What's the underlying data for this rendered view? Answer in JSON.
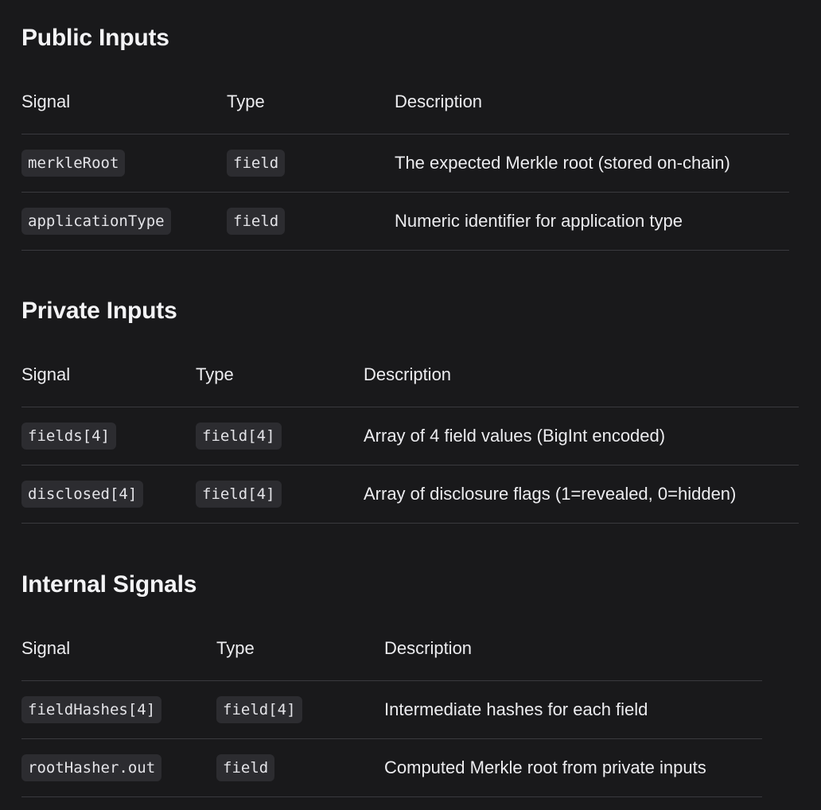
{
  "sections": {
    "public": {
      "title": "Public Inputs",
      "headers": [
        "Signal",
        "Type",
        "Description"
      ],
      "rows": [
        {
          "signal": "merkleRoot",
          "type": "field",
          "description": "The expected Merkle root (stored on-chain)"
        },
        {
          "signal": "applicationType",
          "type": "field",
          "description": "Numeric identifier for application type"
        }
      ]
    },
    "private": {
      "title": "Private Inputs",
      "headers": [
        "Signal",
        "Type",
        "Description"
      ],
      "rows": [
        {
          "signal": "fields[4]",
          "type": "field[4]",
          "description": "Array of 4 field values (BigInt encoded)"
        },
        {
          "signal": "disclosed[4]",
          "type": "field[4]",
          "description": "Array of disclosure flags (1=revealed, 0=hidden)"
        }
      ]
    },
    "internal": {
      "title": "Internal Signals",
      "headers": [
        "Signal",
        "Type",
        "Description"
      ],
      "rows": [
        {
          "signal": "fieldHashes[4]",
          "type": "field[4]",
          "description": "Intermediate hashes for each field"
        },
        {
          "signal": "rootHasher.out",
          "type": "field",
          "description": "Computed Merkle root from private inputs"
        }
      ]
    }
  }
}
